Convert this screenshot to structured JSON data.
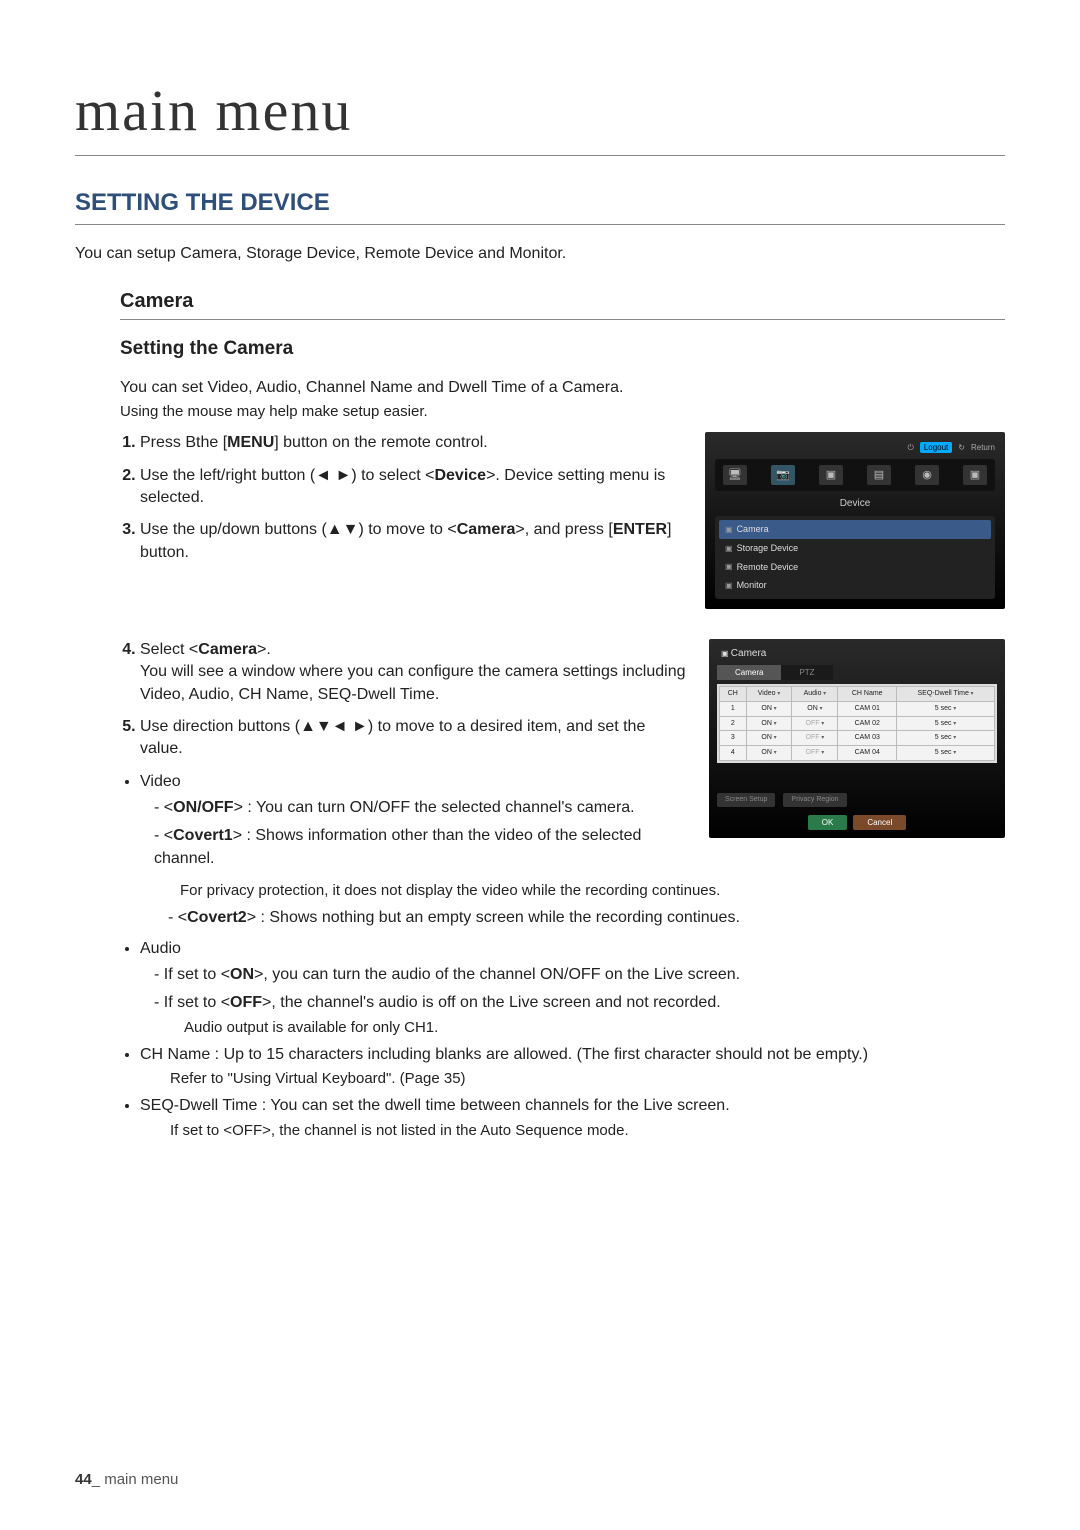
{
  "page_title": "main menu",
  "section_title": "SETTING THE DEVICE",
  "intro": "You can setup Camera, Storage Device, Remote Device and Monitor.",
  "subsection_title": "Camera",
  "subsub_title": "Setting the Camera",
  "lead": "You can set Video, Audio, Channel Name and Dwell Time of a Camera.",
  "hint": "Using the mouse may help make setup easier.",
  "steps_a": {
    "s1_a": "Press Bthe [",
    "s1_b": "] button on the remote control.",
    "s1_bold": "MENU",
    "s2_a": "Use the left/right button (◄ ►) to select <",
    "s2_bold": "Device",
    "s2_b": ">. Device setting menu is selected.",
    "s3_a": "Use the up/down buttons (▲▼) to move to <",
    "s3_bold": "Camera",
    "s3_b": ">, and press [",
    "s3_bold2": "ENTER",
    "s3_c": "] button."
  },
  "fig1": {
    "logout": "Logout",
    "return": "Return",
    "device_label": "Device",
    "menu": [
      "Camera",
      "Storage Device",
      "Remote Device",
      "Monitor"
    ]
  },
  "steps_b": {
    "s4_a": "Select <",
    "s4_bold": "Camera",
    "s4_b": ">.",
    "s4_desc": "You will see a window where you can configure the camera settings including Video, Audio, CH Name, SEQ-Dwell Time.",
    "s5": "Use direction buttons (▲▼◄ ►) to move to a desired item, and set the value."
  },
  "fig2": {
    "title": "Camera",
    "tabs": [
      "Camera",
      "PTZ"
    ],
    "headers": [
      "CH",
      "Video",
      "Audio",
      "CH Name",
      "SEQ-Dwell Time"
    ],
    "rows": [
      {
        "ch": "1",
        "video": "ON",
        "audio": "ON",
        "audio_dim": false,
        "name": "CAM 01",
        "dwell": "5 sec"
      },
      {
        "ch": "2",
        "video": "ON",
        "audio": "OFF",
        "audio_dim": true,
        "name": "CAM 02",
        "dwell": "5 sec"
      },
      {
        "ch": "3",
        "video": "ON",
        "audio": "OFF",
        "audio_dim": true,
        "name": "CAM 03",
        "dwell": "5 sec"
      },
      {
        "ch": "4",
        "video": "ON",
        "audio": "OFF",
        "audio_dim": true,
        "name": "CAM 04",
        "dwell": "5 sec"
      }
    ],
    "btn_screen": "Screen Setup",
    "btn_privacy": "Privacy Region",
    "ok": "OK",
    "cancel": "Cancel"
  },
  "bullets": {
    "video_label": "Video",
    "video_onoff_a": "<",
    "video_onoff_bold": "ON/OFF",
    "video_onoff_b": "> : You can turn ON/OFF the selected channel's camera.",
    "video_c1_a": "<",
    "video_c1_bold": "Covert1",
    "video_c1_b": "> : Shows information other than the video of the selected channel.",
    "video_c1_note": "For privacy protection, it does not display the video while the recording continues.",
    "video_c2_a": "<",
    "video_c2_bold": "Covert2",
    "video_c2_b": "> : Shows nothing but an empty screen while the recording continues.",
    "audio_label": "Audio",
    "audio_on_a": "If set to <",
    "audio_on_bold": "ON",
    "audio_on_b": ">, you can turn the audio of the channel ON/OFF on the Live screen.",
    "audio_off_a": "If set to <",
    "audio_off_bold": "OFF",
    "audio_off_b": ">, the channel's audio is off on the Live screen and not recorded.",
    "audio_note": "Audio output is available for only CH1.",
    "chname": "CH Name : Up to 15 characters including blanks are allowed. (The first character should not be empty.)",
    "chname_note_a": "Refer to \"",
    "chname_note_bold": "Using Virtual Keyboard",
    "chname_note_b": "\". (Page 35)",
    "seq": "SEQ-Dwell Time : You can set the dwell time between channels for the Live screen.",
    "seq_note_a": "If set to <",
    "seq_note_bold": "OFF",
    "seq_note_b": ">, the channel is not listed in the Auto Sequence mode."
  },
  "footer": {
    "pagenum": "44",
    "label": "_ main menu"
  }
}
